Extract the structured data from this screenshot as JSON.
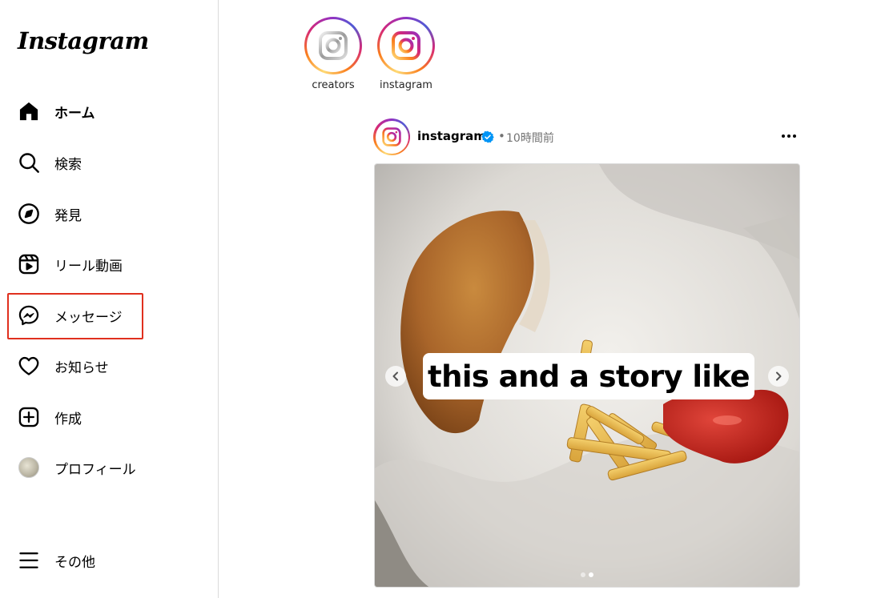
{
  "app": {
    "logo_text": "Instagram"
  },
  "sidebar": {
    "items": [
      {
        "label": "ホーム",
        "icon": "home-icon",
        "active": true
      },
      {
        "label": "検索",
        "icon": "search-icon"
      },
      {
        "label": "発見",
        "icon": "compass-icon"
      },
      {
        "label": "リール動画",
        "icon": "reels-icon"
      },
      {
        "label": "メッセージ",
        "icon": "messenger-icon",
        "highlighted": true
      },
      {
        "label": "お知らせ",
        "icon": "heart-icon"
      },
      {
        "label": "作成",
        "icon": "create-plus-icon"
      },
      {
        "label": "プロフィール",
        "icon": "profile-avatar"
      }
    ],
    "more": {
      "label": "その他",
      "icon": "hamburger-menu-icon"
    },
    "highlight_color": "#e0301e"
  },
  "stories": [
    {
      "username": "creators"
    },
    {
      "username": "instagram"
    }
  ],
  "post": {
    "username": "instagram",
    "verified": true,
    "separator": "•",
    "time": "10時間前",
    "caption_overlay": "this and a story like",
    "carousel_dots": 2,
    "active_dot": 1
  },
  "colors": {
    "accent_blue": "#0095f6",
    "text_secondary": "#737373",
    "border": "#dbdbdb"
  }
}
